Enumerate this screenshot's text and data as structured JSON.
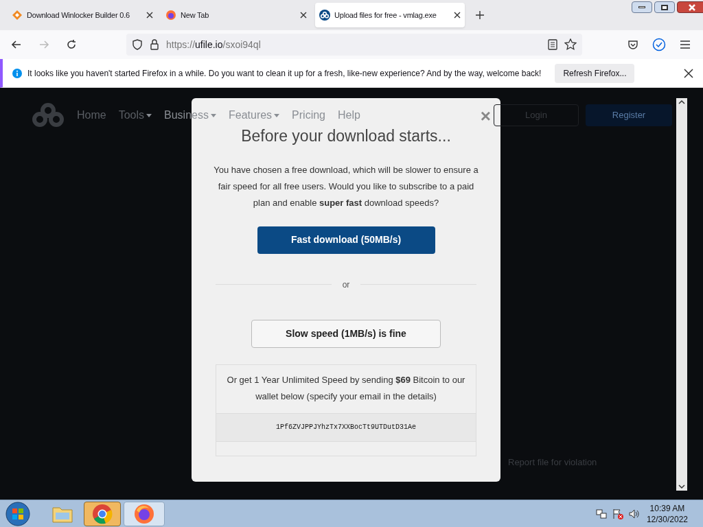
{
  "tabs": [
    {
      "title": "Download Winlocker Builder 0.6",
      "selected": false
    },
    {
      "title": "New Tab",
      "selected": false
    },
    {
      "title": "Upload files for free - vmlag.exe",
      "selected": true
    }
  ],
  "address": {
    "scheme": "https://",
    "domain": "ufile.io",
    "path": "/sxoi94ql"
  },
  "notification": {
    "text": "It looks like you haven't started Firefox in a while. Do you want to clean it up for a fresh, like-new experience? And by the way, welcome back!",
    "button": "Refresh Firefox..."
  },
  "site_nav": {
    "items": [
      {
        "label": "Home",
        "dropdown": false
      },
      {
        "label": "Tools",
        "dropdown": true
      },
      {
        "label": "Business",
        "dropdown": true
      },
      {
        "label": "Features",
        "dropdown": true
      },
      {
        "label": "Pricing",
        "dropdown": false
      },
      {
        "label": "Help",
        "dropdown": false
      }
    ],
    "login": "Login",
    "register": "Register"
  },
  "report_link": "Report file for violation",
  "modal": {
    "close": "×",
    "title": "Before your download starts...",
    "text": "You have chosen a free download, which will be slower to ensure a fair speed for all free users. Would you like to subscribe to a paid plan and enable **super fast** download speeds?",
    "fast_button": "Fast download (50MB/s)",
    "divider": "or",
    "slow_button": "Slow speed (1MB/s) is fine",
    "offer": "Or get 1 Year Unlimited Speed by sending **$69** Bitcoin to our wallet below (specify your email in the details)",
    "wallet": "1Pf6ZVJPPJYhzTx7XXBocTt9UTDutD31Ae"
  },
  "taskbar": {
    "time": "10:39 AM",
    "date": "12/30/2022",
    "apps": [
      {
        "kind": "folder",
        "active": false
      },
      {
        "kind": "chrome",
        "active": true
      },
      {
        "kind": "firefox",
        "active": false
      }
    ]
  }
}
